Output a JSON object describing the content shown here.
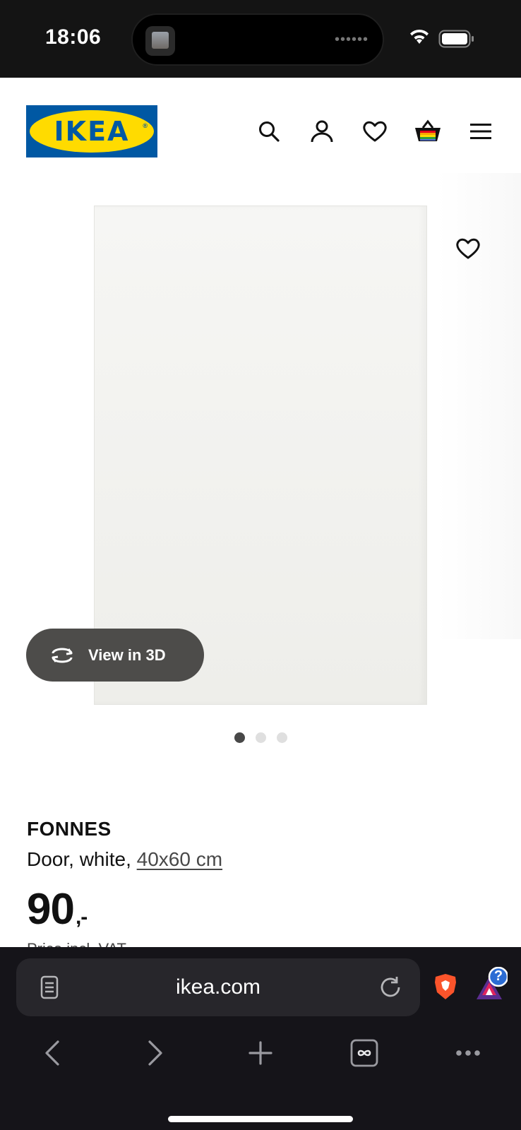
{
  "status_bar": {
    "time": "18:06",
    "island_dots": "••••••"
  },
  "header": {
    "logo_text": "IKEA",
    "logo_reg": "®",
    "icons": [
      "search-icon",
      "profile-icon",
      "heart-icon",
      "basket-icon",
      "menu-icon"
    ]
  },
  "gallery": {
    "view_3d_label": "View in 3D",
    "slide_count": 3,
    "active_slide": 1
  },
  "product": {
    "name": "FONNES",
    "description": "Door, white, ",
    "size_link": "40x60 cm",
    "price_main": "90",
    "price_suffix": ",-",
    "price_note": "Price incl. VAT"
  },
  "browser": {
    "url": "ikea.com",
    "nav": [
      "back-icon",
      "forward-icon",
      "new-tab-icon",
      "tabs-icon",
      "more-icon"
    ],
    "rewards_badge": "?"
  },
  "colors": {
    "ikea_blue": "#0058a3",
    "ikea_yellow": "#ffdb00",
    "pill_bg": "#4d4c4a",
    "browser_bg": "#151419",
    "brave_orange": "#fb542b"
  }
}
